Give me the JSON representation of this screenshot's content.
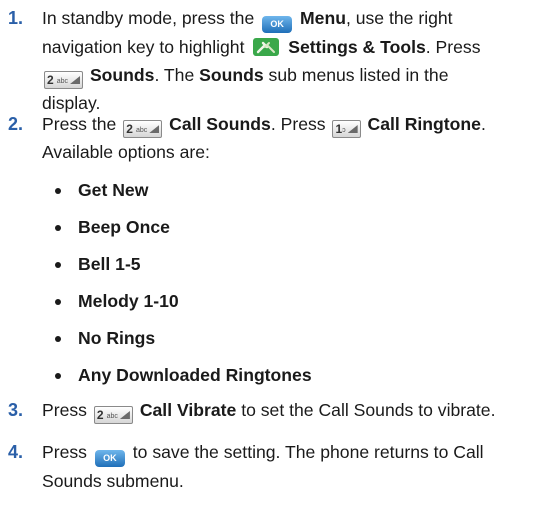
{
  "steps": [
    {
      "number": "1.",
      "line1_a": "In standby mode, press the",
      "ok_key": "OK",
      "line1_b": "Menu",
      "line1_c": ", use the right",
      "line2_a": "navigation key to highlight",
      "line2_b": "Settings & Tools",
      "line2_c": ". Press",
      "key_2": "2",
      "key_2_sub": "abc",
      "line3_b": "Sounds",
      "line3_c": ". The",
      "line3_d": "Sounds",
      "line3_e": "sub menus listed in the",
      "line4": "display."
    },
    {
      "number": "2.",
      "line1_a": "Press the",
      "key_2": "2",
      "key_2_sub": "abc",
      "line1_b": "Call Sounds",
      "line1_c": ". Press",
      "key_1": "1",
      "key_1_sub": "ↄ",
      "line1_d": "Call Ringtone",
      "line1_e": ".",
      "line2": "Available options are:",
      "options": [
        "Get New",
        "Beep Once",
        "Bell 1-5",
        "Melody 1-10",
        "No Rings",
        "Any Downloaded Ringtones"
      ]
    },
    {
      "number": "3.",
      "line1_a": "Press",
      "key_2": "2",
      "key_2_sub": "abc",
      "line1_b": "Call Vibrate",
      "line1_c": "to set the Call Sounds to vibrate."
    },
    {
      "number": "4.",
      "line1_a": "Press",
      "ok_key": "OK",
      "line1_b": "to save the setting. The phone returns to Call",
      "line2": "Sounds submenu."
    }
  ]
}
